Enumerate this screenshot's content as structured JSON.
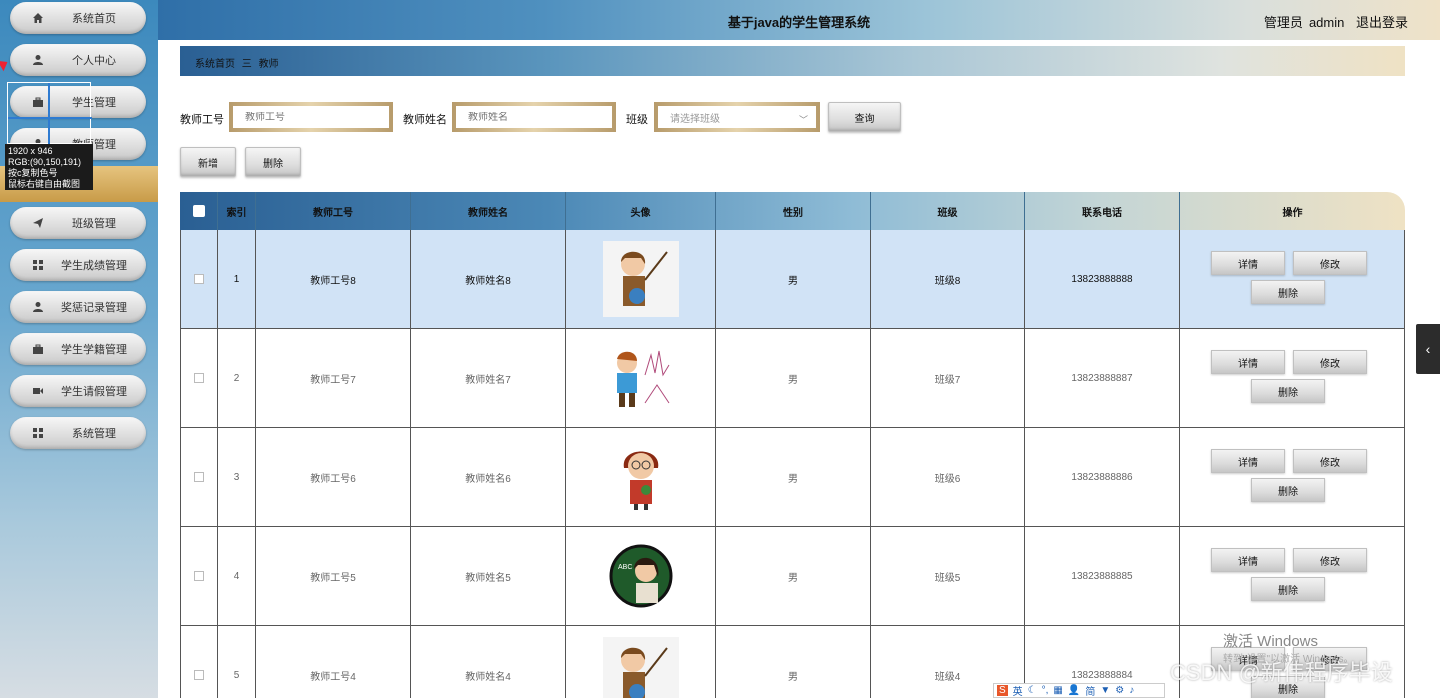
{
  "header": {
    "title": "基于java的学生管理系统",
    "user_role": "管理员",
    "user_name": "admin",
    "logout": "退出登录"
  },
  "sidebar": {
    "items": [
      {
        "label": "系统首页",
        "icon": "home-icon"
      },
      {
        "label": "个人中心",
        "icon": "user-icon"
      },
      {
        "label": "学生管理",
        "icon": "briefcase-icon"
      },
      {
        "label": "教师管理",
        "icon": "user-icon"
      },
      {
        "label": "班级管理",
        "icon": "send-icon"
      },
      {
        "label": "学生成绩管理",
        "icon": "grid-icon"
      },
      {
        "label": "奖惩记录管理",
        "icon": "user-icon"
      },
      {
        "label": "学生学籍管理",
        "icon": "briefcase-icon"
      },
      {
        "label": "学生请假管理",
        "icon": "video-icon"
      },
      {
        "label": "系统管理",
        "icon": "grid-icon"
      }
    ]
  },
  "screenshot_tool": {
    "size": "1920 x 946",
    "rgb": "RGB:(90,150,191)",
    "hint1": "按c复制色号",
    "hint2": "鼠标右键自由截图"
  },
  "breadcrumb": {
    "home": "系统首页",
    "sep": "三",
    "current": "教师"
  },
  "search": {
    "teacher_no_label": "教师工号",
    "teacher_no_placeholder": "教师工号",
    "teacher_name_label": "教师姓名",
    "teacher_name_placeholder": "教师姓名",
    "class_label": "班级",
    "class_placeholder": "请选择班级",
    "query_button": "查询"
  },
  "actions": {
    "add": "新增",
    "delete": "删除"
  },
  "table": {
    "columns": [
      "",
      "索引",
      "教师工号",
      "教师姓名",
      "头像",
      "性别",
      "班级",
      "联系电话",
      "操作"
    ],
    "rows": [
      {
        "index": "1",
        "no": "教师工号8",
        "name": "教师姓名8",
        "gender": "男",
        "class": "班级8",
        "phone": "13823888888"
      },
      {
        "index": "2",
        "no": "教师工号7",
        "name": "教师姓名7",
        "gender": "男",
        "class": "班级7",
        "phone": "13823888887"
      },
      {
        "index": "3",
        "no": "教师工号6",
        "name": "教师姓名6",
        "gender": "男",
        "class": "班级6",
        "phone": "13823888886"
      },
      {
        "index": "4",
        "no": "教师工号5",
        "name": "教师姓名5",
        "gender": "男",
        "class": "班级5",
        "phone": "13823888885"
      },
      {
        "index": "5",
        "no": "教师工号4",
        "name": "教师姓名4",
        "gender": "男",
        "class": "班级4",
        "phone": "13823888884"
      }
    ],
    "op_detail": "详情",
    "op_edit": "修改",
    "op_delete": "删除"
  },
  "watermark": {
    "activate_title": "激活 Windows",
    "activate_sub": "转到\"设置\"以激活 Windows。",
    "csdn": "CSDN @新伟程序毕设"
  },
  "ime": {
    "lang": "英",
    "simp": "简"
  }
}
